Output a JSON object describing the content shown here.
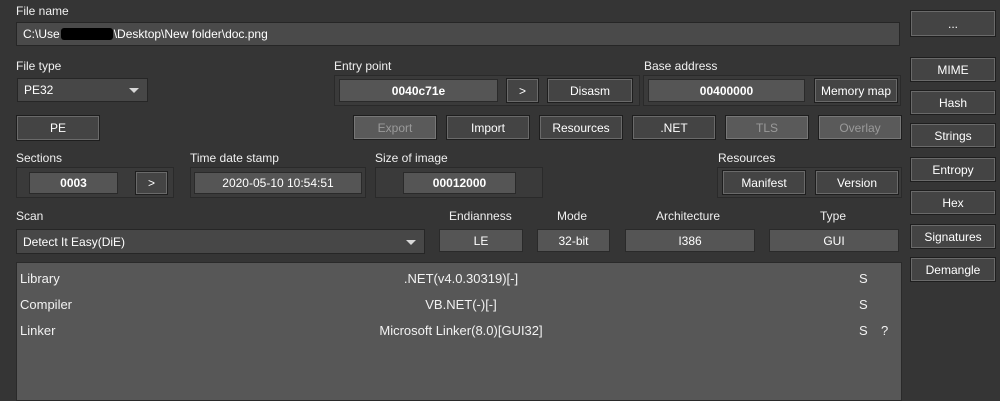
{
  "file_name": {
    "label": "File name",
    "path_prefix": "C:\\Use",
    "path_suffix": "\\Desktop\\New folder\\doc.png",
    "browse_label": "..."
  },
  "file_type": {
    "label": "File type",
    "value": "PE32"
  },
  "pe_button": "PE",
  "entry_point": {
    "label": "Entry point",
    "value": "0040c71e",
    "go_label": ">",
    "disasm_label": "Disasm"
  },
  "base_address": {
    "label": "Base address",
    "value": "00400000",
    "memory_map_label": "Memory map"
  },
  "section_buttons": {
    "export": "Export",
    "import": "Import",
    "resources": "Resources",
    "net": ".NET",
    "tls": "TLS",
    "overlay": "Overlay"
  },
  "sections": {
    "label": "Sections",
    "value": "0003",
    "go_label": ">"
  },
  "time_date_stamp": {
    "label": "Time date stamp",
    "value": "2020-05-10 10:54:51"
  },
  "size_of_image": {
    "label": "Size of image",
    "value": "00012000"
  },
  "resources": {
    "label": "Resources",
    "manifest_label": "Manifest",
    "version_label": "Version"
  },
  "scan": {
    "label": "Scan",
    "value": "Detect It Easy(DiE)"
  },
  "endianness": {
    "label": "Endianness",
    "value": "LE"
  },
  "mode": {
    "label": "Mode",
    "value": "32-bit"
  },
  "architecture": {
    "label": "Architecture",
    "value": "I386"
  },
  "type": {
    "label": "Type",
    "value": "GUI"
  },
  "results": [
    {
      "category": "Library",
      "value": ".NET(v4.0.30319)[-]",
      "s": "S",
      "q": ""
    },
    {
      "category": "Compiler",
      "value": "VB.NET(-)[-]",
      "s": "S",
      "q": ""
    },
    {
      "category": "Linker",
      "value": "Microsoft Linker(8.0)[GUI32]",
      "s": "S",
      "q": "?"
    }
  ],
  "side_buttons": {
    "mime": "MIME",
    "hash": "Hash",
    "strings": "Strings",
    "entropy": "Entropy",
    "hex": "Hex",
    "signatures": "Signatures",
    "demangle": "Demangle"
  }
}
